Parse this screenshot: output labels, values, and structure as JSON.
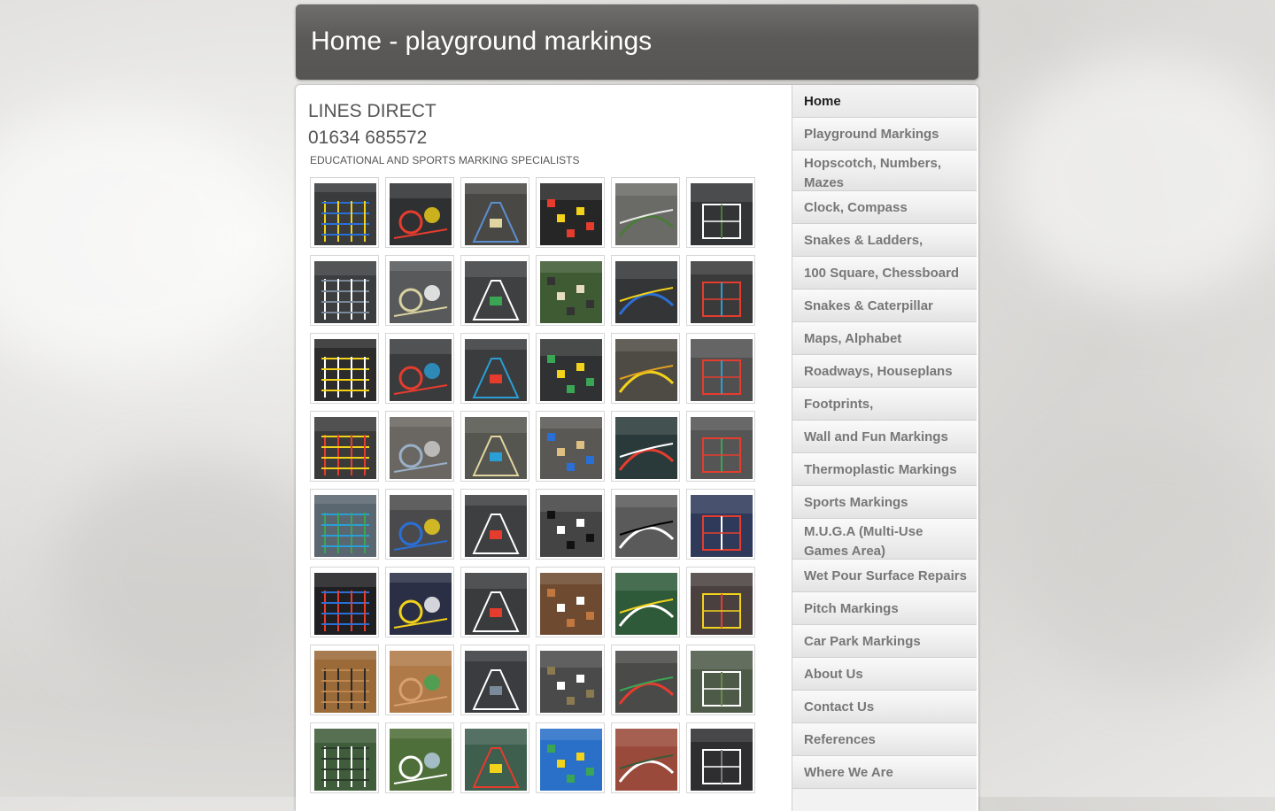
{
  "header": {
    "title": "Home - playground markings"
  },
  "company": {
    "name": "LINES DIRECT",
    "phone": "01634 685572",
    "tagline": "EDUCATIONAL AND SPORTS MARKING SPECIALISTS"
  },
  "nav": {
    "items": [
      {
        "label": "Home",
        "active": true
      },
      {
        "label": "Playground Markings"
      },
      {
        "label": "Hopscotch, Numbers, Mazes"
      },
      {
        "label": "Clock, Compass"
      },
      {
        "label": "Snakes & Ladders,"
      },
      {
        "label": "100 Square, Chessboard"
      },
      {
        "label": "Snakes & Caterpillar"
      },
      {
        "label": "Maps, Alphabet"
      },
      {
        "label": "Roadways, Houseplans"
      },
      {
        "label": "Footprints,"
      },
      {
        "label": "Wall and Fun Markings"
      },
      {
        "label": "Thermoplastic Markings"
      },
      {
        "label": "Sports Markings"
      },
      {
        "label": "M.U.G.A (Multi-Use Games Area)"
      },
      {
        "label": "Wet Pour Surface Repairs"
      },
      {
        "label": "Pitch Markings"
      },
      {
        "label": "Car Park Markings"
      },
      {
        "label": "About Us"
      },
      {
        "label": "Contact Us"
      },
      {
        "label": "References"
      },
      {
        "label": "Where We Are"
      }
    ]
  },
  "gallery": {
    "thumbnails": [
      {
        "icon": "grid-marking-thumb",
        "bg": "#3a3b3c",
        "accent": "#f2d21a",
        "accent2": "#2a6fd6"
      },
      {
        "icon": "circles-marking-thumb",
        "bg": "#2f3031",
        "accent": "#e63c2e",
        "accent2": "#f2d21a"
      },
      {
        "icon": "courtyard-thumb",
        "bg": "#4a4845",
        "accent": "#5a8fd0",
        "accent2": "#e0d4a0"
      },
      {
        "icon": "stars-wall-thumb",
        "bg": "#262626",
        "accent": "#f2d21a",
        "accent2": "#e63c2e"
      },
      {
        "icon": "park-path-thumb",
        "bg": "#6a6b66",
        "accent": "#4b7a3a",
        "accent2": "#e8e8e8"
      },
      {
        "icon": "roadway-thumb",
        "bg": "#333435",
        "accent": "#ffffff",
        "accent2": "#4b7a3a"
      },
      {
        "icon": "track-loop-thumb",
        "bg": "#3c3d3e",
        "accent": "#ffffff",
        "accent2": "#7a8a9a"
      },
      {
        "icon": "lettering-thumb",
        "bg": "#58595b",
        "accent": "#d8d2a0",
        "accent2": "#ffffff"
      },
      {
        "icon": "footprints-thumb",
        "bg": "#3f4041",
        "accent": "#ffffff",
        "accent2": "#3aa655"
      },
      {
        "icon": "maze-grass-thumb",
        "bg": "#3f5b33",
        "accent": "#e8dcc0",
        "accent2": "#333333"
      },
      {
        "icon": "dots-thumb",
        "bg": "#343536",
        "accent": "#2a6fd6",
        "accent2": "#f2d21a"
      },
      {
        "icon": "caterpillar-thumb",
        "bg": "#3a3a3a",
        "accent": "#e63c2e",
        "accent2": "#2a9fd6"
      },
      {
        "icon": "metre-line-thumb",
        "bg": "#2c2c2c",
        "accent": "#ffffff",
        "accent2": "#f2d21a"
      },
      {
        "icon": "alphabet-grid-thumb",
        "bg": "#3a3b3c",
        "accent": "#e63c2e",
        "accent2": "#2a9fd6"
      },
      {
        "icon": "hopscotch-thumb",
        "bg": "#3b3c3d",
        "accent": "#2a9fd6",
        "accent2": "#e63c2e"
      },
      {
        "icon": "hopscotch-yellow-thumb",
        "bg": "#303132",
        "accent": "#f2d21a",
        "accent2": "#3aa655"
      },
      {
        "icon": "grid-yellow-thumb",
        "bg": "#4e4a44",
        "accent": "#f2d21a",
        "accent2": "#e0a020"
      },
      {
        "icon": "compass-thumb",
        "bg": "#505050",
        "accent": "#e63c2e",
        "accent2": "#2a9fd6"
      },
      {
        "icon": "rocket-hopscotch-thumb",
        "bg": "#3a3a3b",
        "accent": "#e63c2e",
        "accent2": "#f2d21a"
      },
      {
        "icon": "houses-street-thumb",
        "bg": "#6a6762",
        "accent": "#9ab0c8",
        "accent2": "#d0d0d0"
      },
      {
        "icon": "road-marking-thumb",
        "bg": "#55564f",
        "accent": "#e0d4a0",
        "accent2": "#2a9fd6"
      },
      {
        "icon": "square-100-thumb",
        "bg": "#5a5855",
        "accent": "#e0c080",
        "accent2": "#2a6fd6"
      },
      {
        "icon": "map-marking-thumb",
        "bg": "#2a3a3a",
        "accent": "#e63c2e",
        "accent2": "#ffffff"
      },
      {
        "icon": "faded-grid-thumb",
        "bg": "#555556",
        "accent": "#e63c2e",
        "accent2": "#3aa655"
      },
      {
        "icon": "crocodile-thumb",
        "bg": "#5a6670",
        "accent": "#3aa655",
        "accent2": "#2a9fd6"
      },
      {
        "icon": "target-thumb",
        "bg": "#4a4a4c",
        "accent": "#2a6fd6",
        "accent2": "#f2d21a"
      },
      {
        "icon": "court-boxes-thumb",
        "bg": "#3e3f40",
        "accent": "#ffffff",
        "accent2": "#e63c2e"
      },
      {
        "icon": "chessboard-thumb",
        "bg": "#444444",
        "accent": "#ffffff",
        "accent2": "#111111"
      },
      {
        "icon": "checker-thumb",
        "bg": "#5a5a5a",
        "accent": "#ffffff",
        "accent2": "#000000"
      },
      {
        "icon": "number-grid-thumb",
        "bg": "#2f3a5a",
        "accent": "#e63c2e",
        "accent2": "#ffffff"
      },
      {
        "icon": "abc-circles-thumb",
        "bg": "#1f1f22",
        "accent": "#e63c2e",
        "accent2": "#2a6fd6"
      },
      {
        "icon": "wxyz-thumb",
        "bg": "#2a2f45",
        "accent": "#f2d21a",
        "accent2": "#ffffff"
      },
      {
        "icon": "ladder-thumb",
        "bg": "#3a3b3c",
        "accent": "#ffffff",
        "accent2": "#e63c2e"
      },
      {
        "icon": "sports-hall-thumb",
        "bg": "#6e4a30",
        "accent": "#ffffff",
        "accent2": "#c07840"
      },
      {
        "icon": "green-court-thumb",
        "bg": "#2f5a3a",
        "accent": "#ffffff",
        "accent2": "#f2d21a"
      },
      {
        "icon": "hall-lines-thumb",
        "bg": "#4a4040",
        "accent": "#f2d21a",
        "accent2": "#e63c2e"
      },
      {
        "icon": "wood-floor-thumb",
        "bg": "#9a6a38",
        "accent": "#2a2a2a",
        "accent2": "#c08850"
      },
      {
        "icon": "parquet-thumb",
        "bg": "#b07a48",
        "accent": "#d8a070",
        "accent2": "#3aa655"
      },
      {
        "icon": "dark-hall-thumb",
        "bg": "#3a3c40",
        "accent": "#ffffff",
        "accent2": "#7a8a9a"
      },
      {
        "icon": "gym-hall-thumb",
        "bg": "#4a4a4a",
        "accent": "#ffffff",
        "accent2": "#8a7a50"
      },
      {
        "icon": "rainbow-track-thumb",
        "bg": "#4a4a48",
        "accent": "#e63c2e",
        "accent2": "#3aa655"
      },
      {
        "icon": "outdoor-court-thumb",
        "bg": "#4e5a48",
        "accent": "#ffffff",
        "accent2": "#6a8a4a"
      },
      {
        "icon": "grass-pitch-thumb",
        "bg": "#3f5d3a",
        "accent": "#ffffff",
        "accent2": "#2a3a2a"
      },
      {
        "icon": "field-pitch-thumb",
        "bg": "#4f6f3a",
        "accent": "#ffffff",
        "accent2": "#b8d0e8"
      },
      {
        "icon": "olympic-rings-thumb",
        "bg": "#3e5e4e",
        "accent": "#e63c2e",
        "accent2": "#f2d21a"
      },
      {
        "icon": "blue-court-thumb",
        "bg": "#2a70c8",
        "accent": "#f2d21a",
        "accent2": "#3aa655"
      },
      {
        "icon": "tennis-court-thumb",
        "bg": "#9a4a3a",
        "accent": "#ffffff",
        "accent2": "#3a5a3a"
      },
      {
        "icon": "car-park-thumb",
        "bg": "#2e2e30",
        "accent": "#ffffff",
        "accent2": "#7a7a7a"
      }
    ]
  }
}
